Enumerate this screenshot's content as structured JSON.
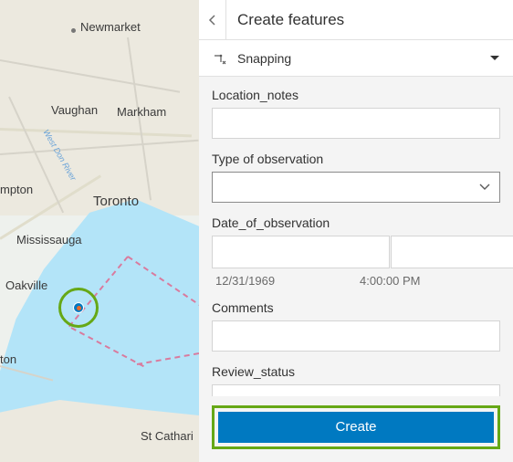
{
  "panel": {
    "title": "Create features"
  },
  "snapping": {
    "label": "Snapping"
  },
  "form": {
    "location_notes": {
      "label": "Location_notes",
      "value": ""
    },
    "type": {
      "label": "Type of observation",
      "value": ""
    },
    "date": {
      "label": "Date_of_observation",
      "date_display": "12/31/1969",
      "time_display": "4:00:00 PM"
    },
    "comments": {
      "label": "Comments",
      "value": ""
    },
    "review": {
      "label": "Review_status",
      "value": ""
    }
  },
  "actions": {
    "create_label": "Create"
  },
  "map": {
    "labels": {
      "newmarket": "Newmarket",
      "vaughan": "Vaughan",
      "markham": "Markham",
      "toronto": "Toronto",
      "mississauga": "Mississauga",
      "oakville": "Oakville",
      "hampton_cut": "mpton",
      "burlington_cut": "ton",
      "stcath_cut": "St Cathari",
      "river": "West Don River"
    }
  }
}
